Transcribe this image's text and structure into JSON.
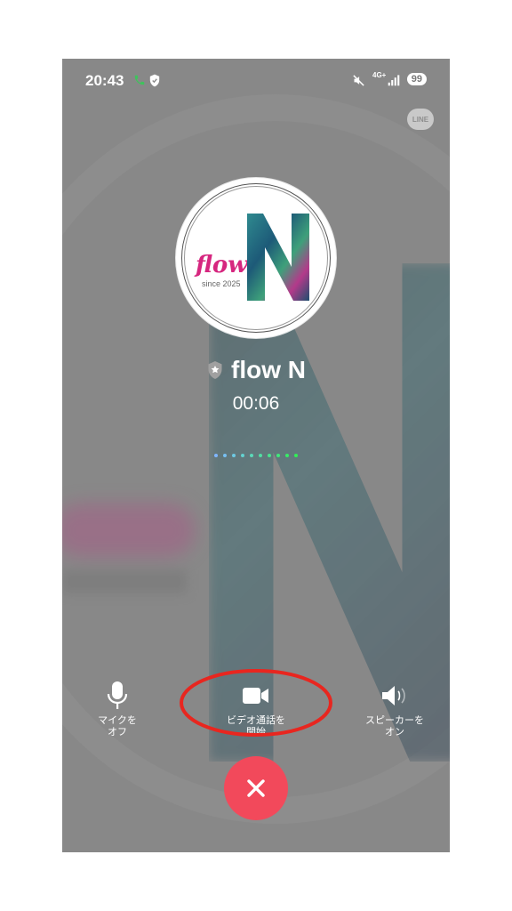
{
  "status_bar": {
    "time": "20:43",
    "network": "4G+",
    "battery": "99"
  },
  "app_badge": "LINE",
  "avatar": {
    "brand": "flow",
    "since": "since 2025"
  },
  "contact": {
    "name": "flow N"
  },
  "call": {
    "duration": "00:06"
  },
  "controls": {
    "mic": {
      "line1": "マイクを",
      "line2": "オフ"
    },
    "video": {
      "line1": "ビデオ通話を",
      "line2": "開始"
    },
    "speaker": {
      "line1": "スピーカーを",
      "line2": "オン"
    }
  },
  "colors": {
    "end_call": "#f2495b",
    "annotation": "#e8261f",
    "brand_pink": "#d6267f"
  }
}
